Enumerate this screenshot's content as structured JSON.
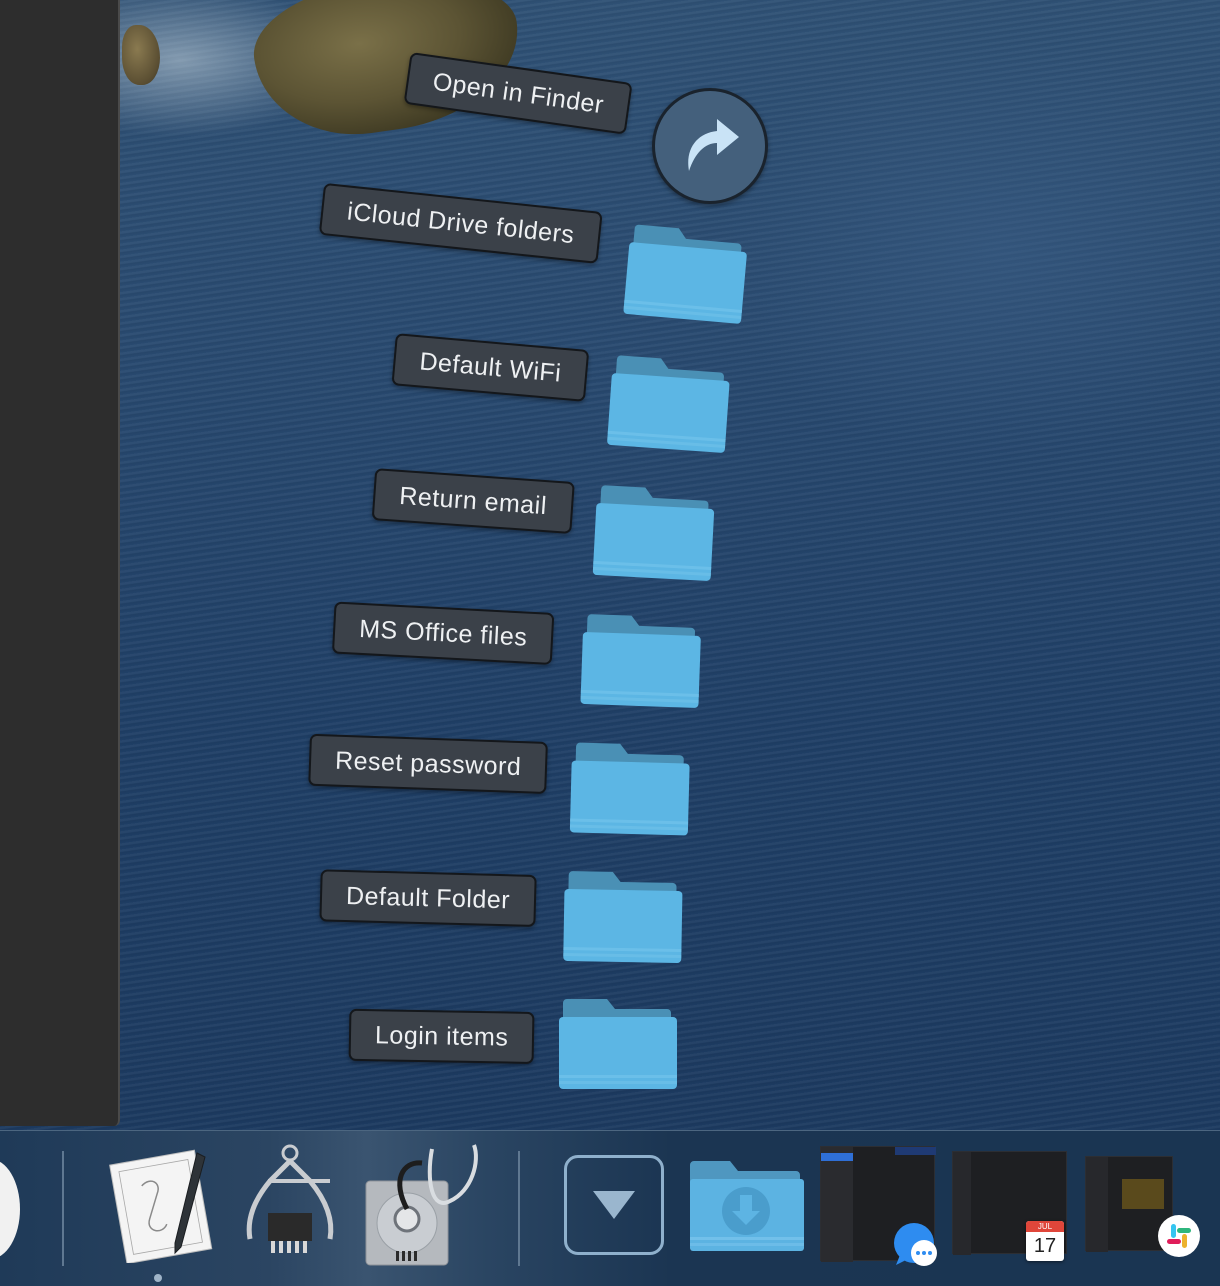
{
  "sidebar": {
    "label": ""
  },
  "stack": {
    "open_in_finder": {
      "label": "Open in Finder",
      "icon": "curved-arrow-icon"
    },
    "items": [
      {
        "label": "iCloud Drive folders",
        "icon": "folder-icon"
      },
      {
        "label": "Default WiFi",
        "icon": "folder-icon"
      },
      {
        "label": "Return email",
        "icon": "folder-icon"
      },
      {
        "label": "MS Office files",
        "icon": "folder-icon"
      },
      {
        "label": "Reset password",
        "icon": "folder-icon"
      },
      {
        "label": "Default Folder",
        "icon": "folder-icon"
      },
      {
        "label": "Login items",
        "icon": "folder-icon"
      }
    ]
  },
  "dock": {
    "apps": [
      {
        "name": "Script Editor",
        "icon": "script-editor-icon",
        "running": true
      },
      {
        "name": "System Information",
        "icon": "system-information-icon",
        "running": false
      },
      {
        "name": "Disk Utility",
        "icon": "disk-utility-icon",
        "running": false
      }
    ],
    "stacks": [
      {
        "name": "Stack",
        "icon": "stack-chevron-down-icon"
      },
      {
        "name": "Downloads",
        "icon": "downloads-folder-icon"
      }
    ],
    "minimized_windows": [
      {
        "name": "Messages",
        "icon": "messages-icon"
      },
      {
        "name": "Calendar",
        "icon": "calendar-icon",
        "calendar_month": "JUL",
        "calendar_day": "17"
      },
      {
        "name": "Slack",
        "icon": "slack-icon"
      }
    ]
  },
  "colors": {
    "label_bg": "#3b4149",
    "label_text": "#eef0f2",
    "folder_blue": "#5cb6e4",
    "dock_bg": "#1b3552",
    "desktop_blue": "#294a70"
  }
}
